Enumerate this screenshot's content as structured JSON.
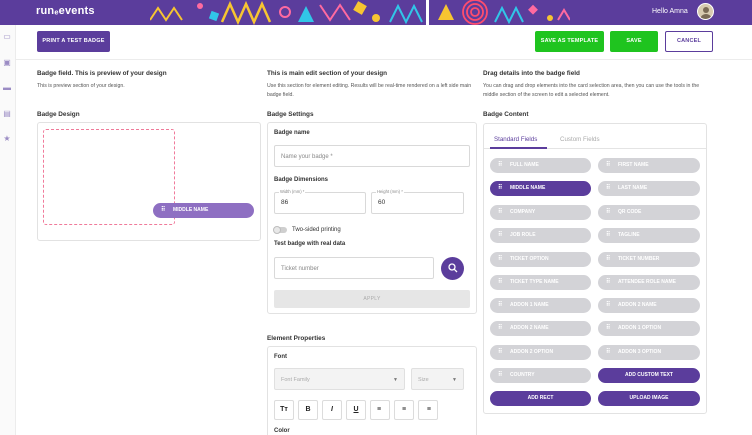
{
  "app": {
    "logo": "runₑevents",
    "greeting": "Hello Amna"
  },
  "colors": {
    "brand": "#5b3d9c",
    "success": "#1fc41f",
    "accent_dashed": "#f07a9a"
  },
  "toolbar": {
    "print_label": "PRINT A TEST BADGE",
    "save_template_label": "SAVE AS TEMPLATE",
    "save_label": "SAVE",
    "cancel_label": "CANCEL"
  },
  "left_panel": {
    "title": "Badge field. This is preview of your design",
    "desc": "This is preview section of your design.",
    "design_label": "Badge Design",
    "preview_pill": "MIDDLE NAME"
  },
  "middle_panel": {
    "title": "This is main edit section of your design",
    "desc": "Use this section for element editing. Results will be real-time rendered on a left side main badge field.",
    "settings_label": "Badge Settings",
    "name_label": "Badge name",
    "name_placeholder": "Name your badge *",
    "dims_label": "Badge Dimensions",
    "width_label": "Width (mm) *",
    "width_value": "86",
    "height_label": "Height (mm) *",
    "height_value": "60",
    "two_sided_label": "Two-sided printing",
    "test_label": "Test badge with real data",
    "ticket_placeholder": "Ticket number",
    "apply_label": "APPLY",
    "element_props_label": "Element Properties",
    "font_label": "Font",
    "font_family_placeholder": "Font Family",
    "size_placeholder": "Size",
    "format_buttons": [
      "Tт",
      "B",
      "I",
      "U",
      "≡",
      "≡",
      "≡"
    ],
    "color_label": "Color"
  },
  "right_panel": {
    "title": "Drag details into the badge field",
    "desc": "You can drag and drop elements into the card selection area, then you can use the tools in the middle section of the screen to edit a selected element.",
    "content_label": "Badge Content",
    "tabs": [
      "Standard Fields",
      "Custom Fields"
    ],
    "fields_left": [
      "FULL NAME",
      "MIDDLE NAME",
      "COMPANY",
      "JOB ROLE",
      "TICKET OPTION",
      "TICKET TYPE NAME",
      "ADDON 1 NAME",
      "ADDON 2 NAME",
      "ADDON 2 OPTION",
      "COUNTRY"
    ],
    "fields_right": [
      "FIRST NAME",
      "LAST NAME",
      "QR CODE",
      "TAGLINE",
      "TICKET NUMBER",
      "ATTENDEE ROLE NAME",
      "ADDON 2 NAME",
      "ADDON 1 OPTION",
      "ADDON 3 OPTION"
    ],
    "add_custom_text": "ADD CUSTOM TEXT",
    "add_rect": "ADD RECT",
    "upload_image": "UPLOAD IMAGE"
  }
}
